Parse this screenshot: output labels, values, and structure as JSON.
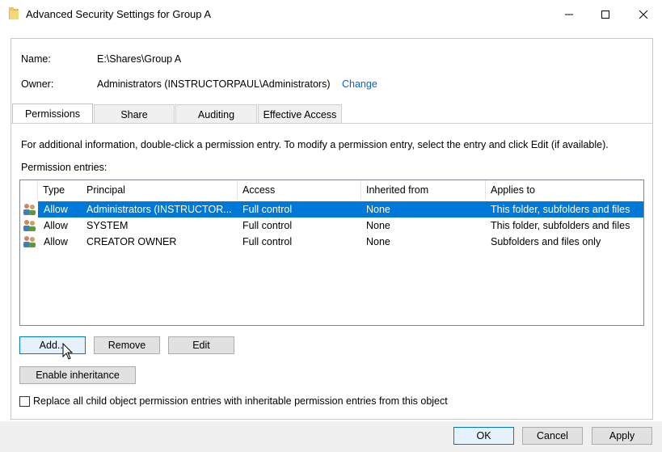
{
  "window": {
    "title": "Advanced Security Settings for Group A",
    "folder_icon": "folder-icon",
    "minimize_icon": "minimize-icon",
    "maximize_icon": "maximize-icon",
    "close_icon": "close-icon"
  },
  "info": {
    "name_label": "Name:",
    "name_value": "E:\\Shares\\Group A",
    "owner_label": "Owner:",
    "owner_value": "Administrators (INSTRUCTORPAUL\\Administrators)",
    "change_link": "Change"
  },
  "tabs": [
    {
      "label": "Permissions",
      "active": true
    },
    {
      "label": "Share",
      "active": false
    },
    {
      "label": "Auditing",
      "active": false
    },
    {
      "label": "Effective Access",
      "active": false
    }
  ],
  "permissions": {
    "info_text": "For additional information, double-click a permission entry. To modify a permission entry, select the entry and click Edit (if available).",
    "entries_label": "Permission entries:",
    "columns": [
      "Type",
      "Principal",
      "Access",
      "Inherited from",
      "Applies to"
    ],
    "rows": [
      {
        "type": "Allow",
        "principal": "Administrators (INSTRUCTOR...",
        "access": "Full control",
        "inherited": "None",
        "applies": "This folder, subfolders and files",
        "selected": true,
        "icon": "users-icon"
      },
      {
        "type": "Allow",
        "principal": "SYSTEM",
        "access": "Full control",
        "inherited": "None",
        "applies": "This folder, subfolders and files",
        "selected": false,
        "icon": "users-icon"
      },
      {
        "type": "Allow",
        "principal": "CREATOR OWNER",
        "access": "Full control",
        "inherited": "None",
        "applies": "Subfolders and files only",
        "selected": false,
        "icon": "users-icon"
      }
    ],
    "add_button": "Add...",
    "remove_button": "Remove",
    "edit_button": "Edit",
    "enable_inheritance_button": "Enable inheritance",
    "replace_checkbox_label": "Replace all child object permission entries with inheritable permission entries from this object",
    "replace_checked": false
  },
  "footer": {
    "ok_button": "OK",
    "cancel_button": "Cancel",
    "apply_button": "Apply"
  },
  "colors": {
    "selection": "#0078d7",
    "link": "#0066cc",
    "footer_bg": "#f0f0f0",
    "button_bg": "#e1e1e1"
  }
}
